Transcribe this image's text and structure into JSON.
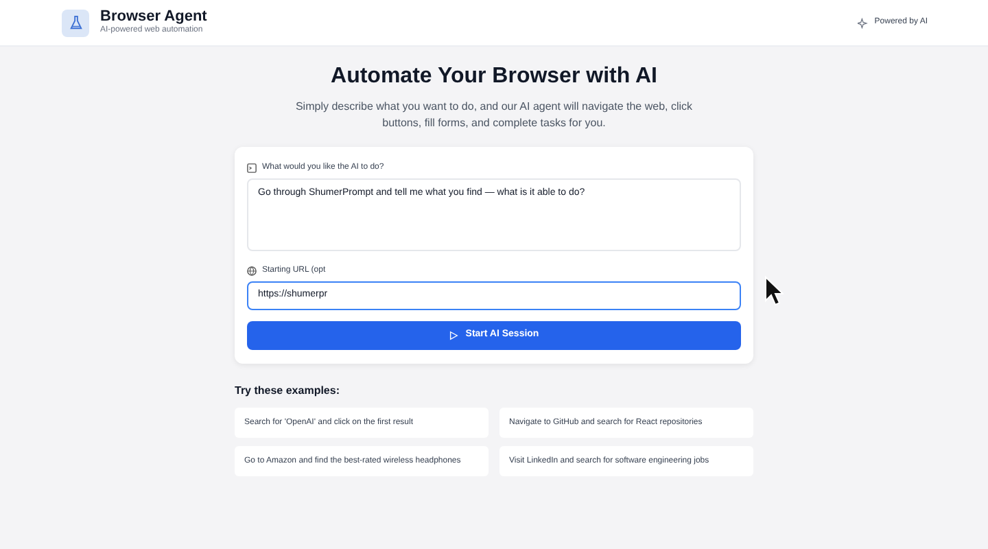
{
  "header": {
    "app_name": "Browser Agent",
    "tagline": "AI-powered web automation",
    "badge": "Powered by AI"
  },
  "hero": {
    "title": "Automate Your Browser with AI",
    "subtitle": "Simply describe what you want to do, and our AI agent will navigate the web, click buttons, fill forms, and complete tasks for you."
  },
  "form": {
    "task_label": "What would you like the AI to do?",
    "task_value": "Go through ShumerPrompt and tell me what you find — what is it able to do?",
    "url_label": "Starting URL (opt",
    "url_value": "https://shumerpr",
    "url_focused": true,
    "submit": "Start AI Session"
  },
  "examples": {
    "title": "Try these examples:",
    "items": [
      {
        "text": "Search for 'OpenAI' and click on the first result"
      },
      {
        "text": "Navigate to GitHub and search for React repositories"
      },
      {
        "text": "Go to Amazon and find the best-rated wireless headphones"
      },
      {
        "text": "Visit LinkedIn and search for software engineering jobs"
      }
    ]
  }
}
